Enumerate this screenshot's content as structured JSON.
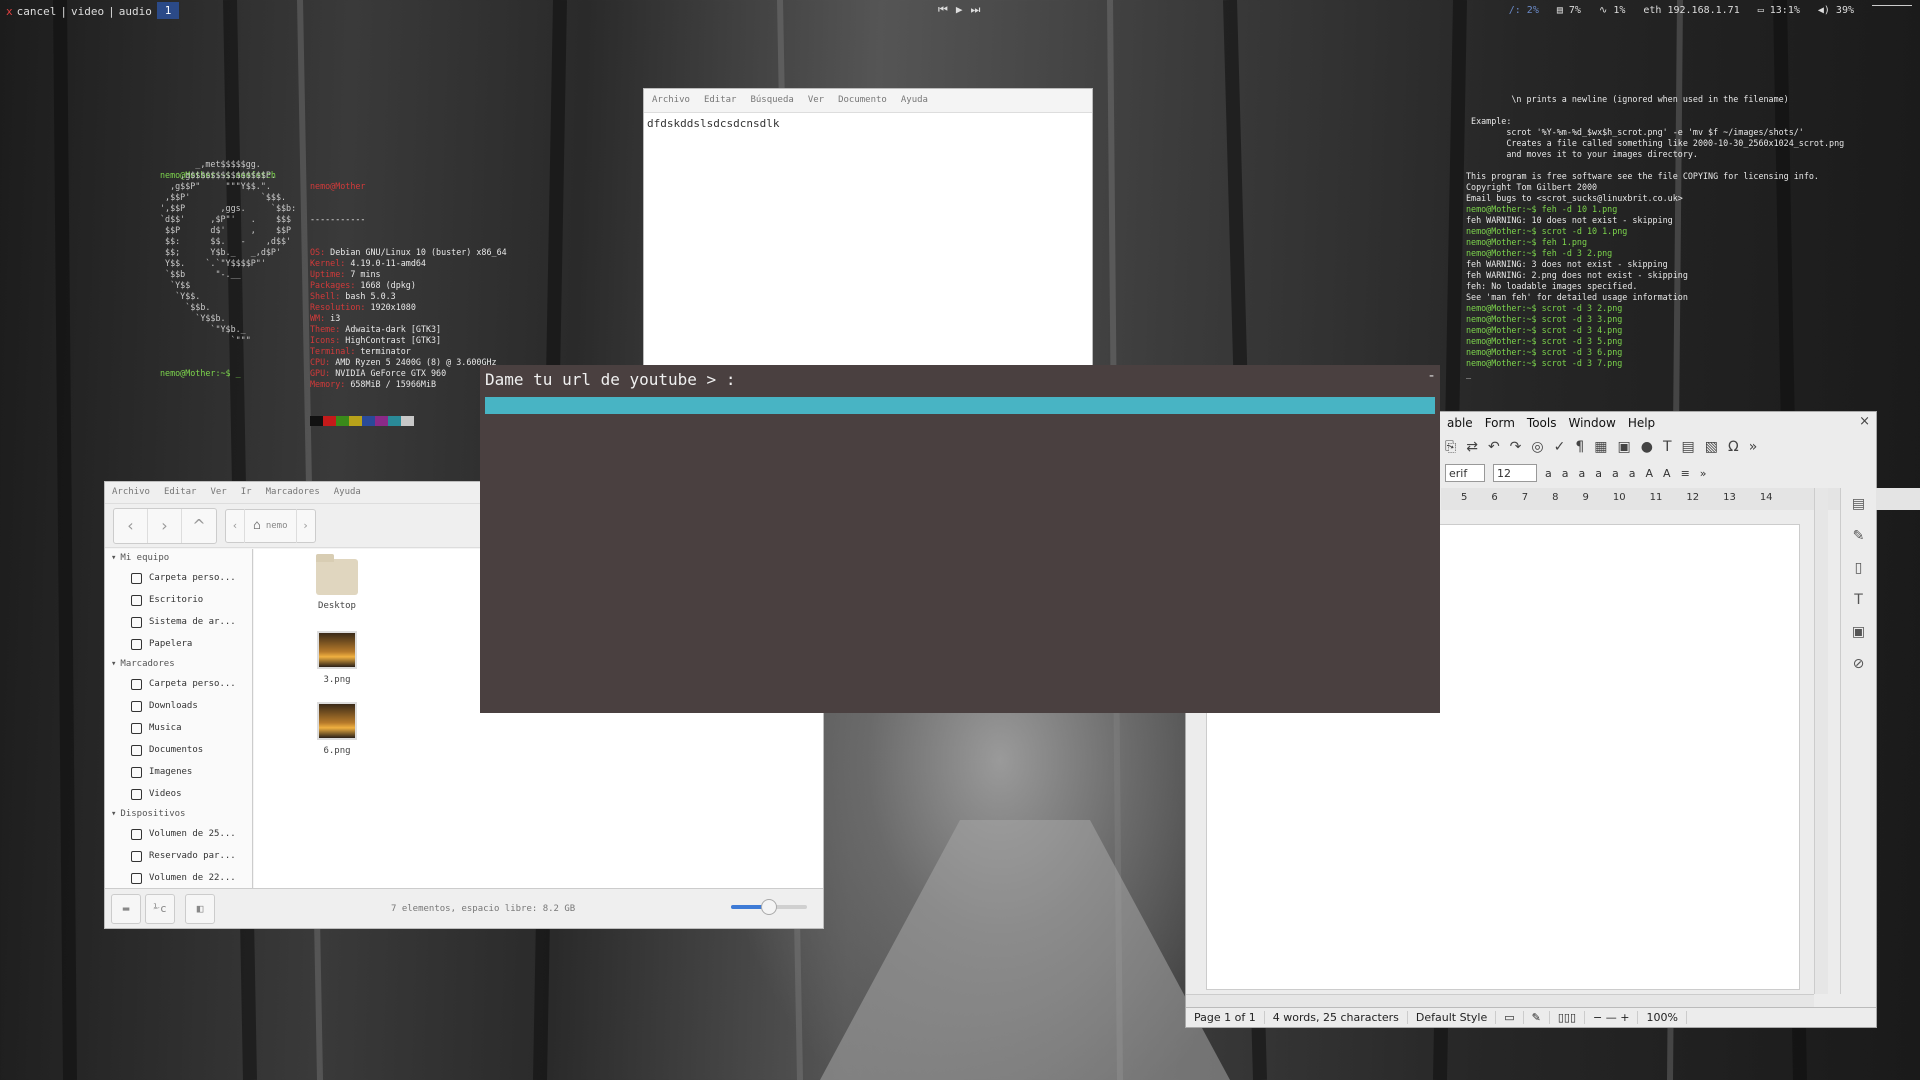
{
  "topbar": {
    "x": "x",
    "left": [
      "cancel",
      "|",
      "video",
      "|",
      "audio"
    ],
    "workspace": "1",
    "media": [
      "⏮",
      "▶",
      "⏭"
    ],
    "right": [
      {
        "t": "/: 2%",
        "dim": true
      },
      {
        "t": "▤ 7%",
        "dim": false
      },
      {
        "t": "∿ 1%",
        "dim": false
      },
      {
        "t": "eth 192.168.1.71",
        "dim": false
      },
      {
        "t": "▭ 13:1%",
        "dim": false
      },
      {
        "t": "◀) 39%",
        "dim": false
      }
    ]
  },
  "neofetch": {
    "prompt1": "nemo@Mother:~$ neofetch",
    "logo": "       _,met$$$$$gg.\n    ,g$$$$$$$$$$$$$$$P.\n  ,g$$P\"     \"\"\"Y$$.\".\n ,$$P'              `$$$.\n',$$P       ,ggs.     `$$b:\n`d$$'     ,$P\"'   .    $$$\n $$P      d$'     ,    $$P\n $$:      $$.   -    ,d$$'\n $$;      Y$b._   _,d$P'\n Y$$.    `.`\"Y$$$$P\"'\n `$$b      \"-.__\n  `Y$$\n   `Y$$.\n     `$$b.\n       `Y$$b.\n          `\"Y$b._\n              `\"\"\"",
    "user": "nemo@Mother",
    "sep": "-----------",
    "info": [
      {
        "k": "OS",
        "v": "Debian GNU/Linux 10 (buster) x86_64"
      },
      {
        "k": "Kernel",
        "v": "4.19.0-11-amd64"
      },
      {
        "k": "Uptime",
        "v": "7 mins"
      },
      {
        "k": "Packages",
        "v": "1668 (dpkg)"
      },
      {
        "k": "Shell",
        "v": "bash 5.0.3"
      },
      {
        "k": "Resolution",
        "v": "1920x1080"
      },
      {
        "k": "WM",
        "v": "i3"
      },
      {
        "k": "Theme",
        "v": "Adwaita-dark [GTK3]"
      },
      {
        "k": "Icons",
        "v": "HighContrast [GTK3]"
      },
      {
        "k": "Terminal",
        "v": "terminator"
      },
      {
        "k": "CPU",
        "v": "AMD Ryzen 5 2400G (8) @ 3.600GHz"
      },
      {
        "k": "GPU",
        "v": "NVIDIA GeForce GTX 960"
      },
      {
        "k": "Memory",
        "v": "658MiB / 15966MiB"
      }
    ],
    "swatches": [
      "#111111",
      "#c41a1a",
      "#3a8a1a",
      "#b8a21a",
      "#2a4a98",
      "#8a2a88",
      "#2a8a98",
      "#c8c8c8"
    ],
    "prompt2": "nemo@Mother:~$ _"
  },
  "gedit": {
    "menu": [
      "Archivo",
      "Editar",
      "Búsqueda",
      "Ver",
      "Documento",
      "Ayuda"
    ],
    "text": "dfdskddslsdcsdcnsdlk"
  },
  "terminal2": {
    "lines": [
      {
        "t": "         \\n prints a newline (ignored when used in the filename)",
        "g": false
      },
      {
        "t": "",
        "g": false
      },
      {
        "t": " Example:",
        "g": false
      },
      {
        "t": "        scrot '%Y-%m-%d_$wx$h_scrot.png' -e 'mv $f ~/images/shots/'",
        "g": false
      },
      {
        "t": "        Creates a file called something like 2000-10-30_2560x1024_scrot.png",
        "g": false
      },
      {
        "t": "        and moves it to your images directory.",
        "g": false
      },
      {
        "t": "",
        "g": false
      },
      {
        "t": "This program is free software see the file COPYING for licensing info.",
        "g": false
      },
      {
        "t": "Copyright Tom Gilbert 2000",
        "g": false
      },
      {
        "t": "Email bugs to <scrot_sucks@linuxbrit.co.uk>",
        "g": false
      },
      {
        "t": "nemo@Mother:~$ feh -d 10 1.png",
        "g": true
      },
      {
        "t": "feh WARNING: 10 does not exist - skipping",
        "g": false
      },
      {
        "t": "nemo@Mother:~$ scrot -d 10 1.png",
        "g": true
      },
      {
        "t": "nemo@Mother:~$ feh 1.png",
        "g": true
      },
      {
        "t": "nemo@Mother:~$ feh -d 3 2.png",
        "g": true
      },
      {
        "t": "feh WARNING: 3 does not exist - skipping",
        "g": false
      },
      {
        "t": "feh WARNING: 2.png does not exist - skipping",
        "g": false
      },
      {
        "t": "feh: No loadable images specified.",
        "g": false
      },
      {
        "t": "See 'man feh' for detailed usage information",
        "g": false
      },
      {
        "t": "nemo@Mother:~$ scrot -d 3 2.png",
        "g": true
      },
      {
        "t": "nemo@Mother:~$ scrot -d 3 3.png",
        "g": true
      },
      {
        "t": "nemo@Mother:~$ scrot -d 3 4.png",
        "g": true
      },
      {
        "t": "nemo@Mother:~$ scrot -d 3 5.png",
        "g": true
      },
      {
        "t": "nemo@Mother:~$ scrot -d 3 6.png",
        "g": true
      },
      {
        "t": "nemo@Mother:~$ scrot -d 3 7.png",
        "g": true
      },
      {
        "t": "_",
        "g": false
      }
    ]
  },
  "filemanager": {
    "menu": [
      "Archivo",
      "Editar",
      "Ver",
      "Ir",
      "Marcadores",
      "Ayuda"
    ],
    "nav": [
      "‹",
      "›",
      "^"
    ],
    "crumb_left": "‹",
    "crumb_right": "›",
    "home_icon": "⌂",
    "path": "nemo",
    "sections": [
      {
        "title": "Mi equipo",
        "items": [
          "Carpeta perso...",
          "Escritorio",
          "Sistema de ar...",
          "Papelera"
        ]
      },
      {
        "title": "Marcadores",
        "items": [
          "Carpeta perso...",
          "Downloads",
          "Musica",
          "Documentos",
          "Imagenes",
          "Videos"
        ]
      },
      {
        "title": "Dispositivos",
        "items": [
          "Volumen de 25...",
          "Reservado par...",
          "Volumen de 22..."
        ]
      }
    ],
    "files": [
      "Desktop",
      "3.png",
      "6.png"
    ],
    "status_buttons": [
      "▬",
      "⅟c",
      "◧"
    ],
    "status": "7 elementos, espacio libre: 8.2 GB",
    "zoom_fraction": 0.5
  },
  "writer": {
    "menu": [
      "able",
      "Form",
      "Tools",
      "Window",
      "Help"
    ],
    "close": "×",
    "tb1": [
      "⎘",
      "⇄",
      "↶",
      "↷",
      "◎",
      "✓",
      "¶",
      "▦",
      "▣",
      "●",
      "T",
      "▤",
      "▧",
      "Ω",
      "»"
    ],
    "font_name": "erif",
    "font_size": "12",
    "tb2": [
      "a",
      "a",
      "a",
      "a",
      "a",
      "a",
      "A",
      "A",
      "≡",
      "»"
    ],
    "ruler": [
      "5",
      "6",
      "7",
      "8",
      "9",
      "10",
      "11",
      "12",
      "13",
      "14"
    ],
    "sidebar_icons": [
      "▤",
      "✎",
      "▯",
      "T",
      "▣",
      "⊘"
    ],
    "status": [
      "Page 1 of 1",
      "4 words, 25 characters",
      "Default Style",
      "▭",
      "✎",
      "▯▯▯",
      "− — + ",
      "100%"
    ]
  },
  "prompt": {
    "label": "Dame tu url de youtube > :",
    "dash": "-"
  }
}
